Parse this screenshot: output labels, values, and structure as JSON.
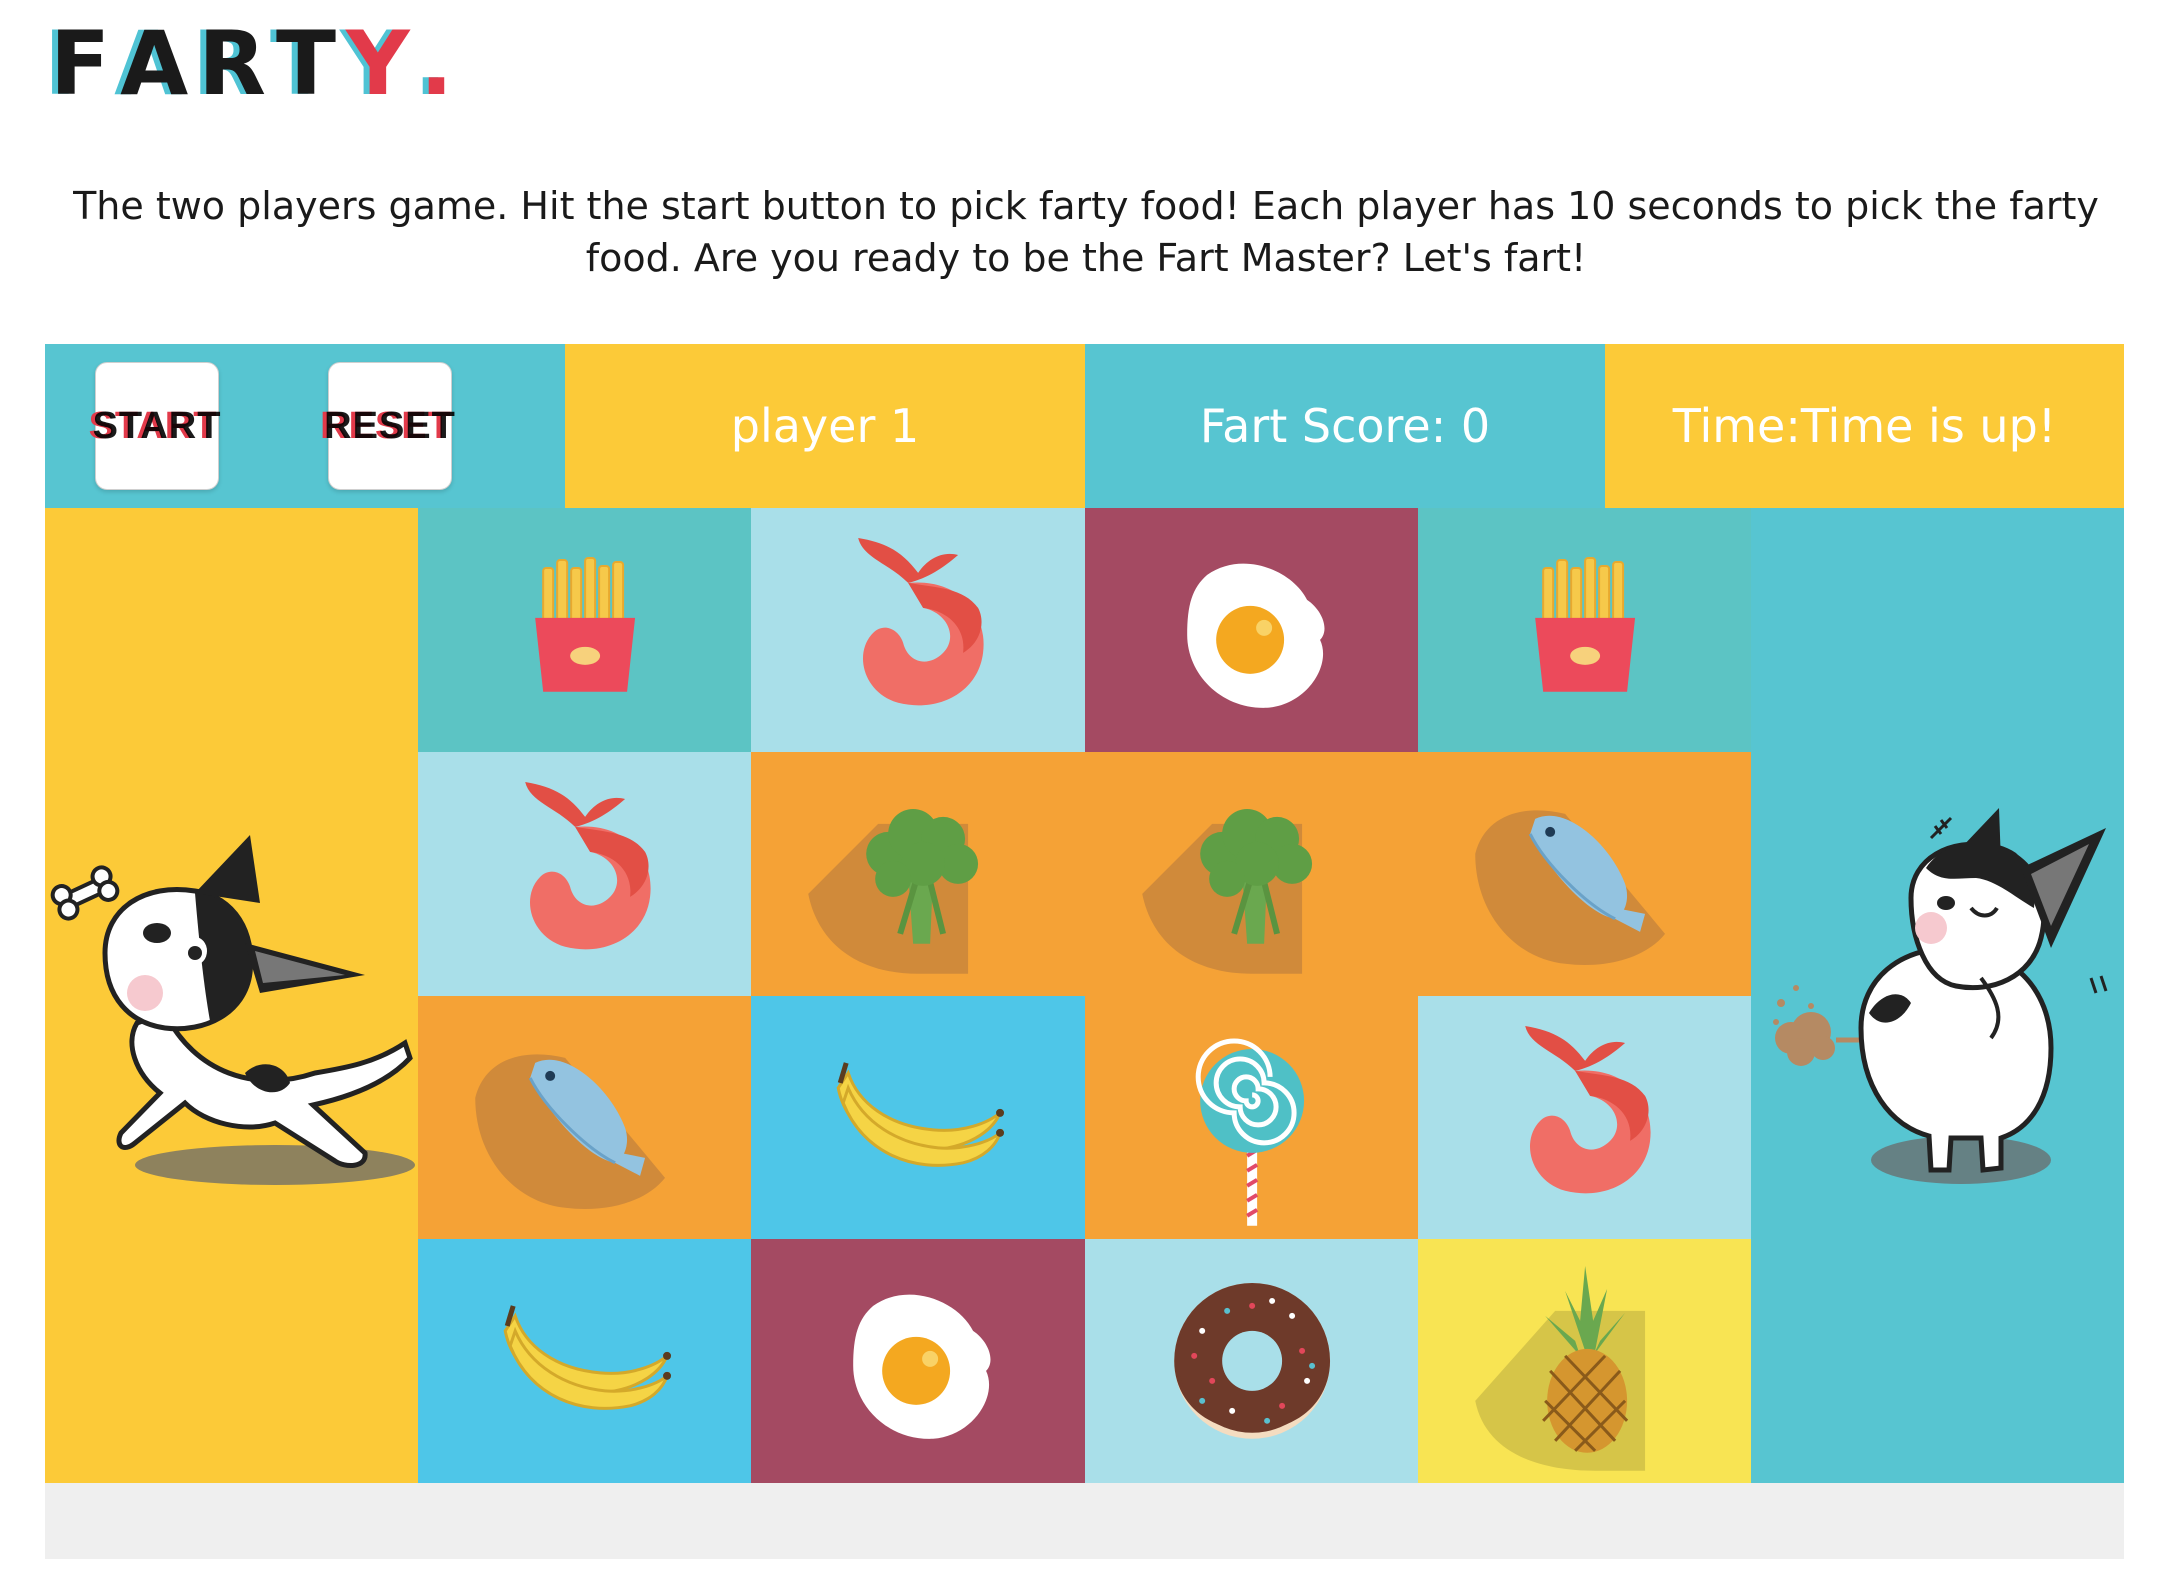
{
  "logo": {
    "letters": [
      "F",
      "A",
      "R",
      "T",
      "Y",
      "."
    ]
  },
  "intro": {
    "line1": "The two players game. Hit the start button to pick farty food! Each player has 10 seconds to pick the farty",
    "line2": "food. Are you ready to be the Fart Master? Let's fart!"
  },
  "controls": {
    "start_label": "START",
    "reset_label": "RESET"
  },
  "status": {
    "player": "player 1",
    "score": "Fart Score: 0",
    "time": "Time:Time is up!"
  },
  "colors": {
    "yellow": "#fcca38",
    "cyan": "#57c5d1",
    "teal": "#5cc4c4",
    "lightblue": "#a9dfe9",
    "maroon": "#a44a62",
    "orange": "#f5a236",
    "skyblue": "#4ec6e8",
    "paleyellow": "#f8e453",
    "red": "#e23a4a"
  },
  "board": {
    "rows": [
      [
        {
          "food": "fries",
          "bg": "teal"
        },
        {
          "food": "shrimp",
          "bg": "lightblue"
        },
        {
          "food": "egg",
          "bg": "maroon"
        },
        {
          "food": "fries",
          "bg": "teal"
        }
      ],
      [
        {
          "food": "shrimp",
          "bg": "lightblue"
        },
        {
          "food": "broccoli",
          "bg": "orange"
        },
        {
          "food": "broccoli",
          "bg": "orange"
        },
        {
          "food": "fish",
          "bg": "orange"
        }
      ],
      [
        {
          "food": "fish",
          "bg": "orange"
        },
        {
          "food": "banana",
          "bg": "skyblue"
        },
        {
          "food": "lollipop",
          "bg": "orange"
        },
        {
          "food": "shrimp",
          "bg": "lightblue"
        }
      ],
      [
        {
          "food": "banana",
          "bg": "skyblue"
        },
        {
          "food": "egg",
          "bg": "maroon"
        },
        {
          "food": "donut",
          "bg": "lightblue"
        },
        {
          "food": "pineapple",
          "bg": "paleyellow"
        }
      ]
    ]
  },
  "players": {
    "left": {
      "icon": "dog-bone-icon"
    },
    "right": {
      "icon": "dog-fart-icon"
    }
  }
}
